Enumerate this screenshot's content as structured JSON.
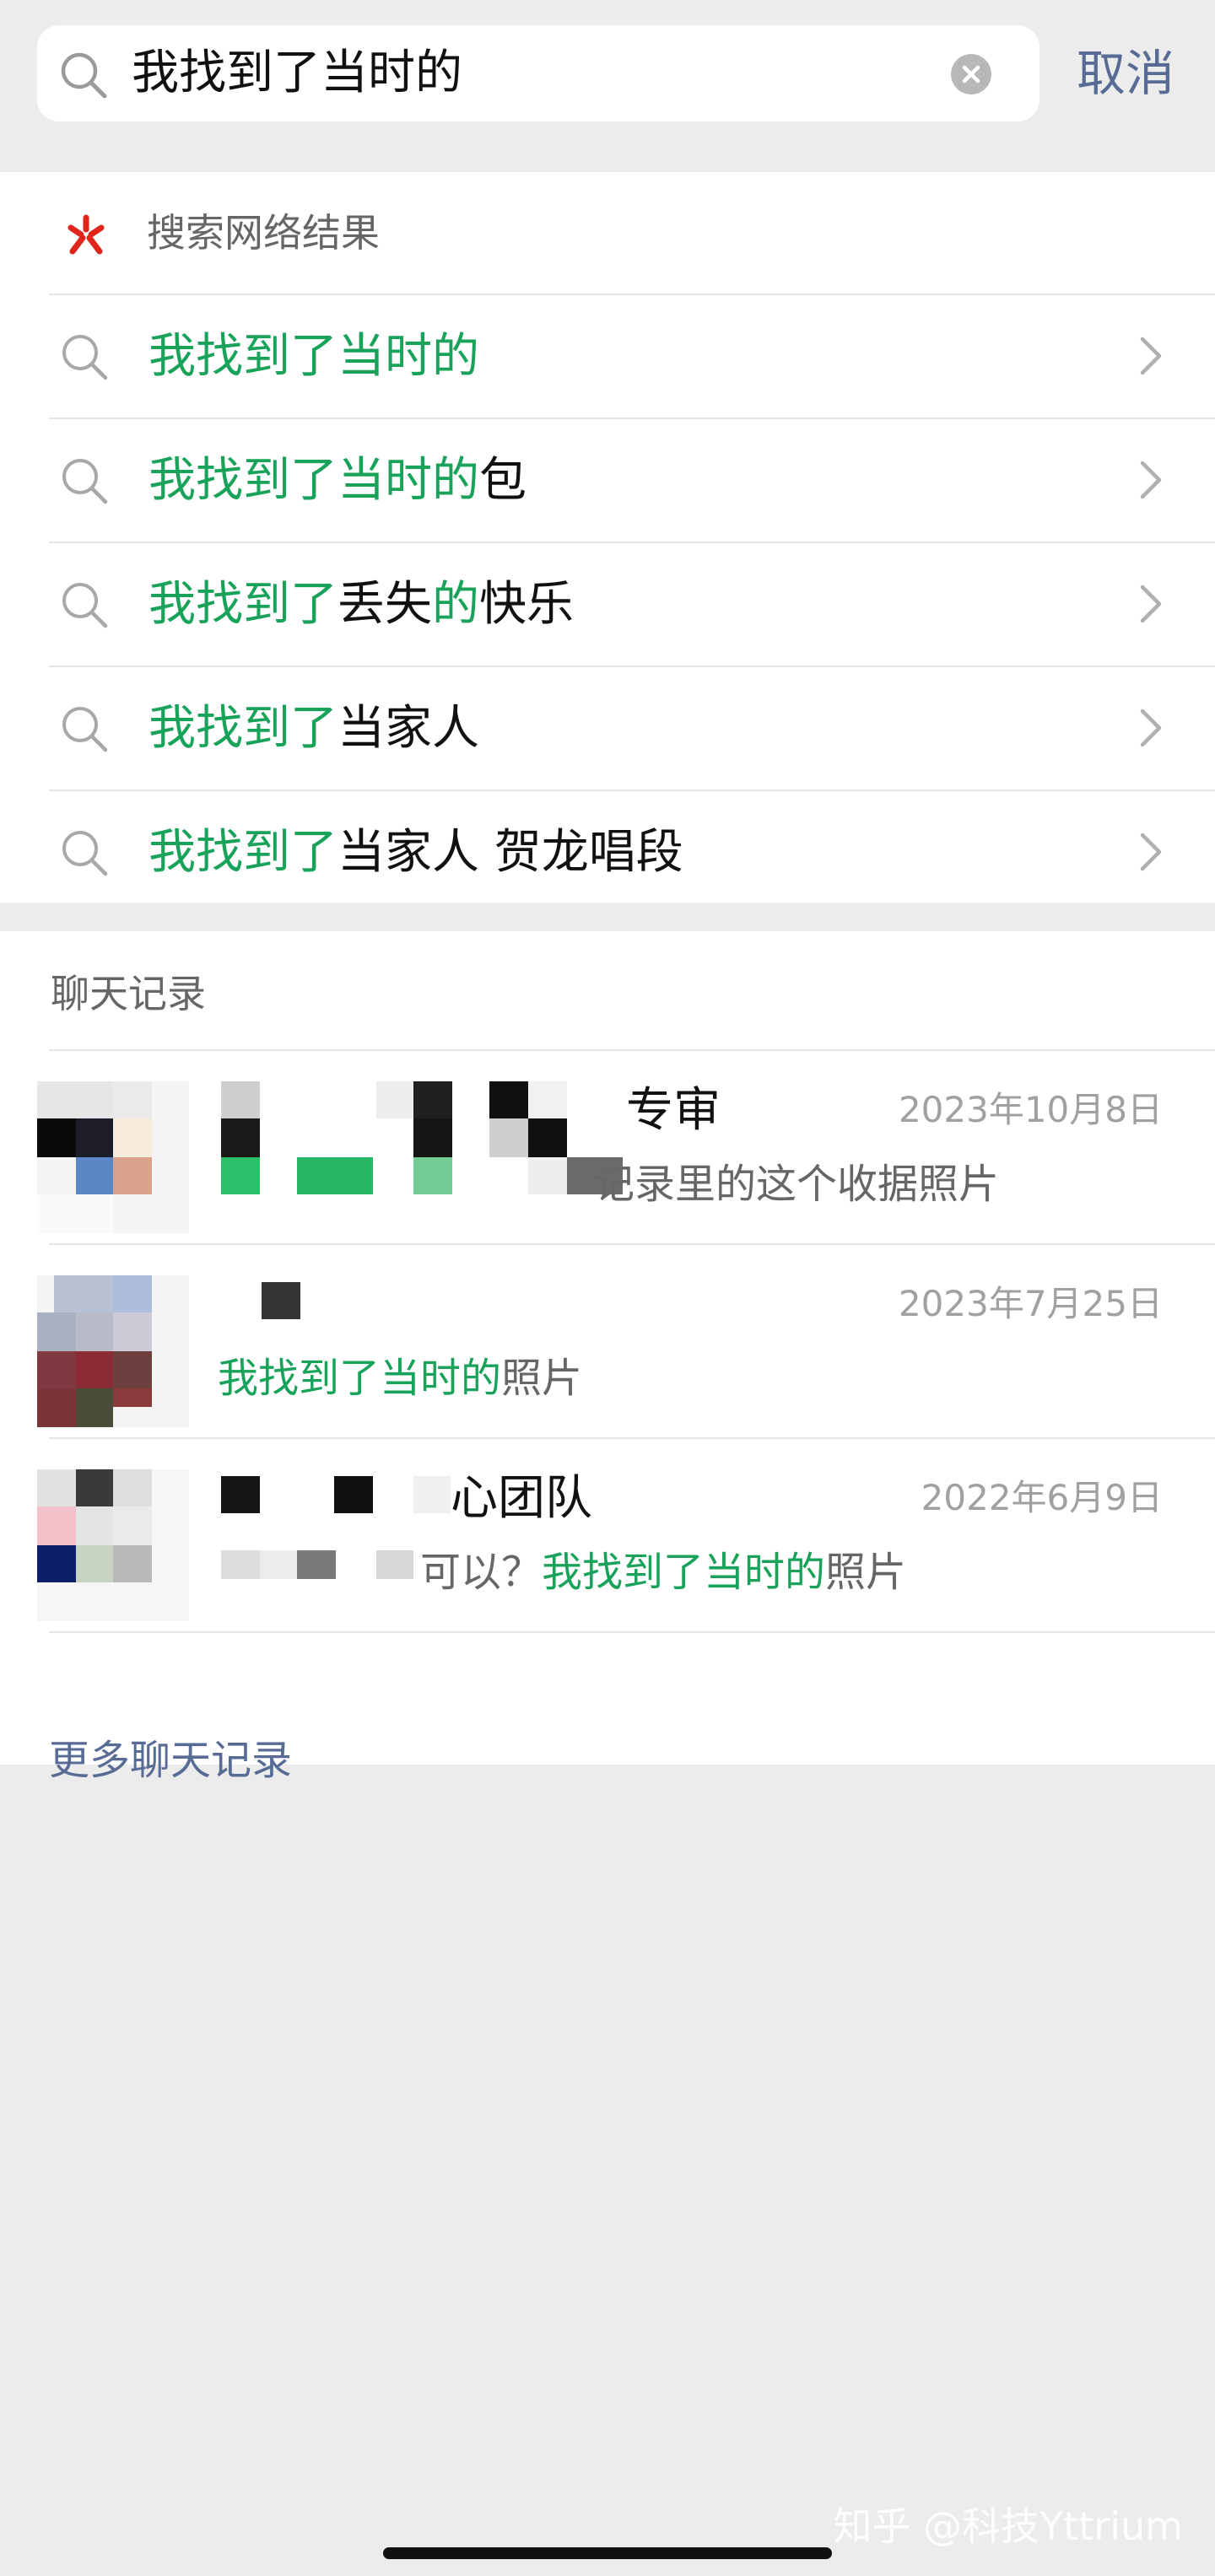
{
  "search": {
    "query": "我找到了当时的",
    "cancel_label": "取消"
  },
  "web_results": {
    "header_label": "搜索网络结果",
    "suggestions": [
      {
        "highlight": "我找到了当时的",
        "rest1": "",
        "highlight2": "",
        "rest2": ""
      },
      {
        "highlight": "我找到了当时的",
        "rest1": "包",
        "highlight2": "",
        "rest2": ""
      },
      {
        "highlight": "我找到了",
        "rest1": "丢失",
        "highlight2": "的",
        "rest2": "快乐"
      },
      {
        "highlight": "我找到了",
        "rest1": "当家人",
        "highlight2": "",
        "rest2": ""
      },
      {
        "highlight": "我找到了",
        "rest1": "当家人 贺龙唱段",
        "highlight2": "",
        "rest2": ""
      }
    ]
  },
  "chat_records": {
    "header_label": "聊天记录",
    "items": [
      {
        "name_visible": "专审",
        "date": "2023年10月8日",
        "msg_prefix": "",
        "msg_highlight": "",
        "msg_suffix": "记录里的这个收据照片"
      },
      {
        "name_visible": "",
        "date": "2023年7月25日",
        "msg_prefix": "",
        "msg_highlight": "我找到了当时的",
        "msg_suffix": "照片"
      },
      {
        "name_visible": "心团队",
        "date": "2022年6月9日",
        "msg_prefix": "可以？",
        "msg_highlight": "我找到了当时的",
        "msg_suffix": "照片"
      }
    ],
    "more_label": "更多聊天记录"
  },
  "watermark": "知乎 @科技Yttrium",
  "colors": {
    "highlight": "#19a35a",
    "link": "#576b95",
    "background": "#ececec"
  }
}
